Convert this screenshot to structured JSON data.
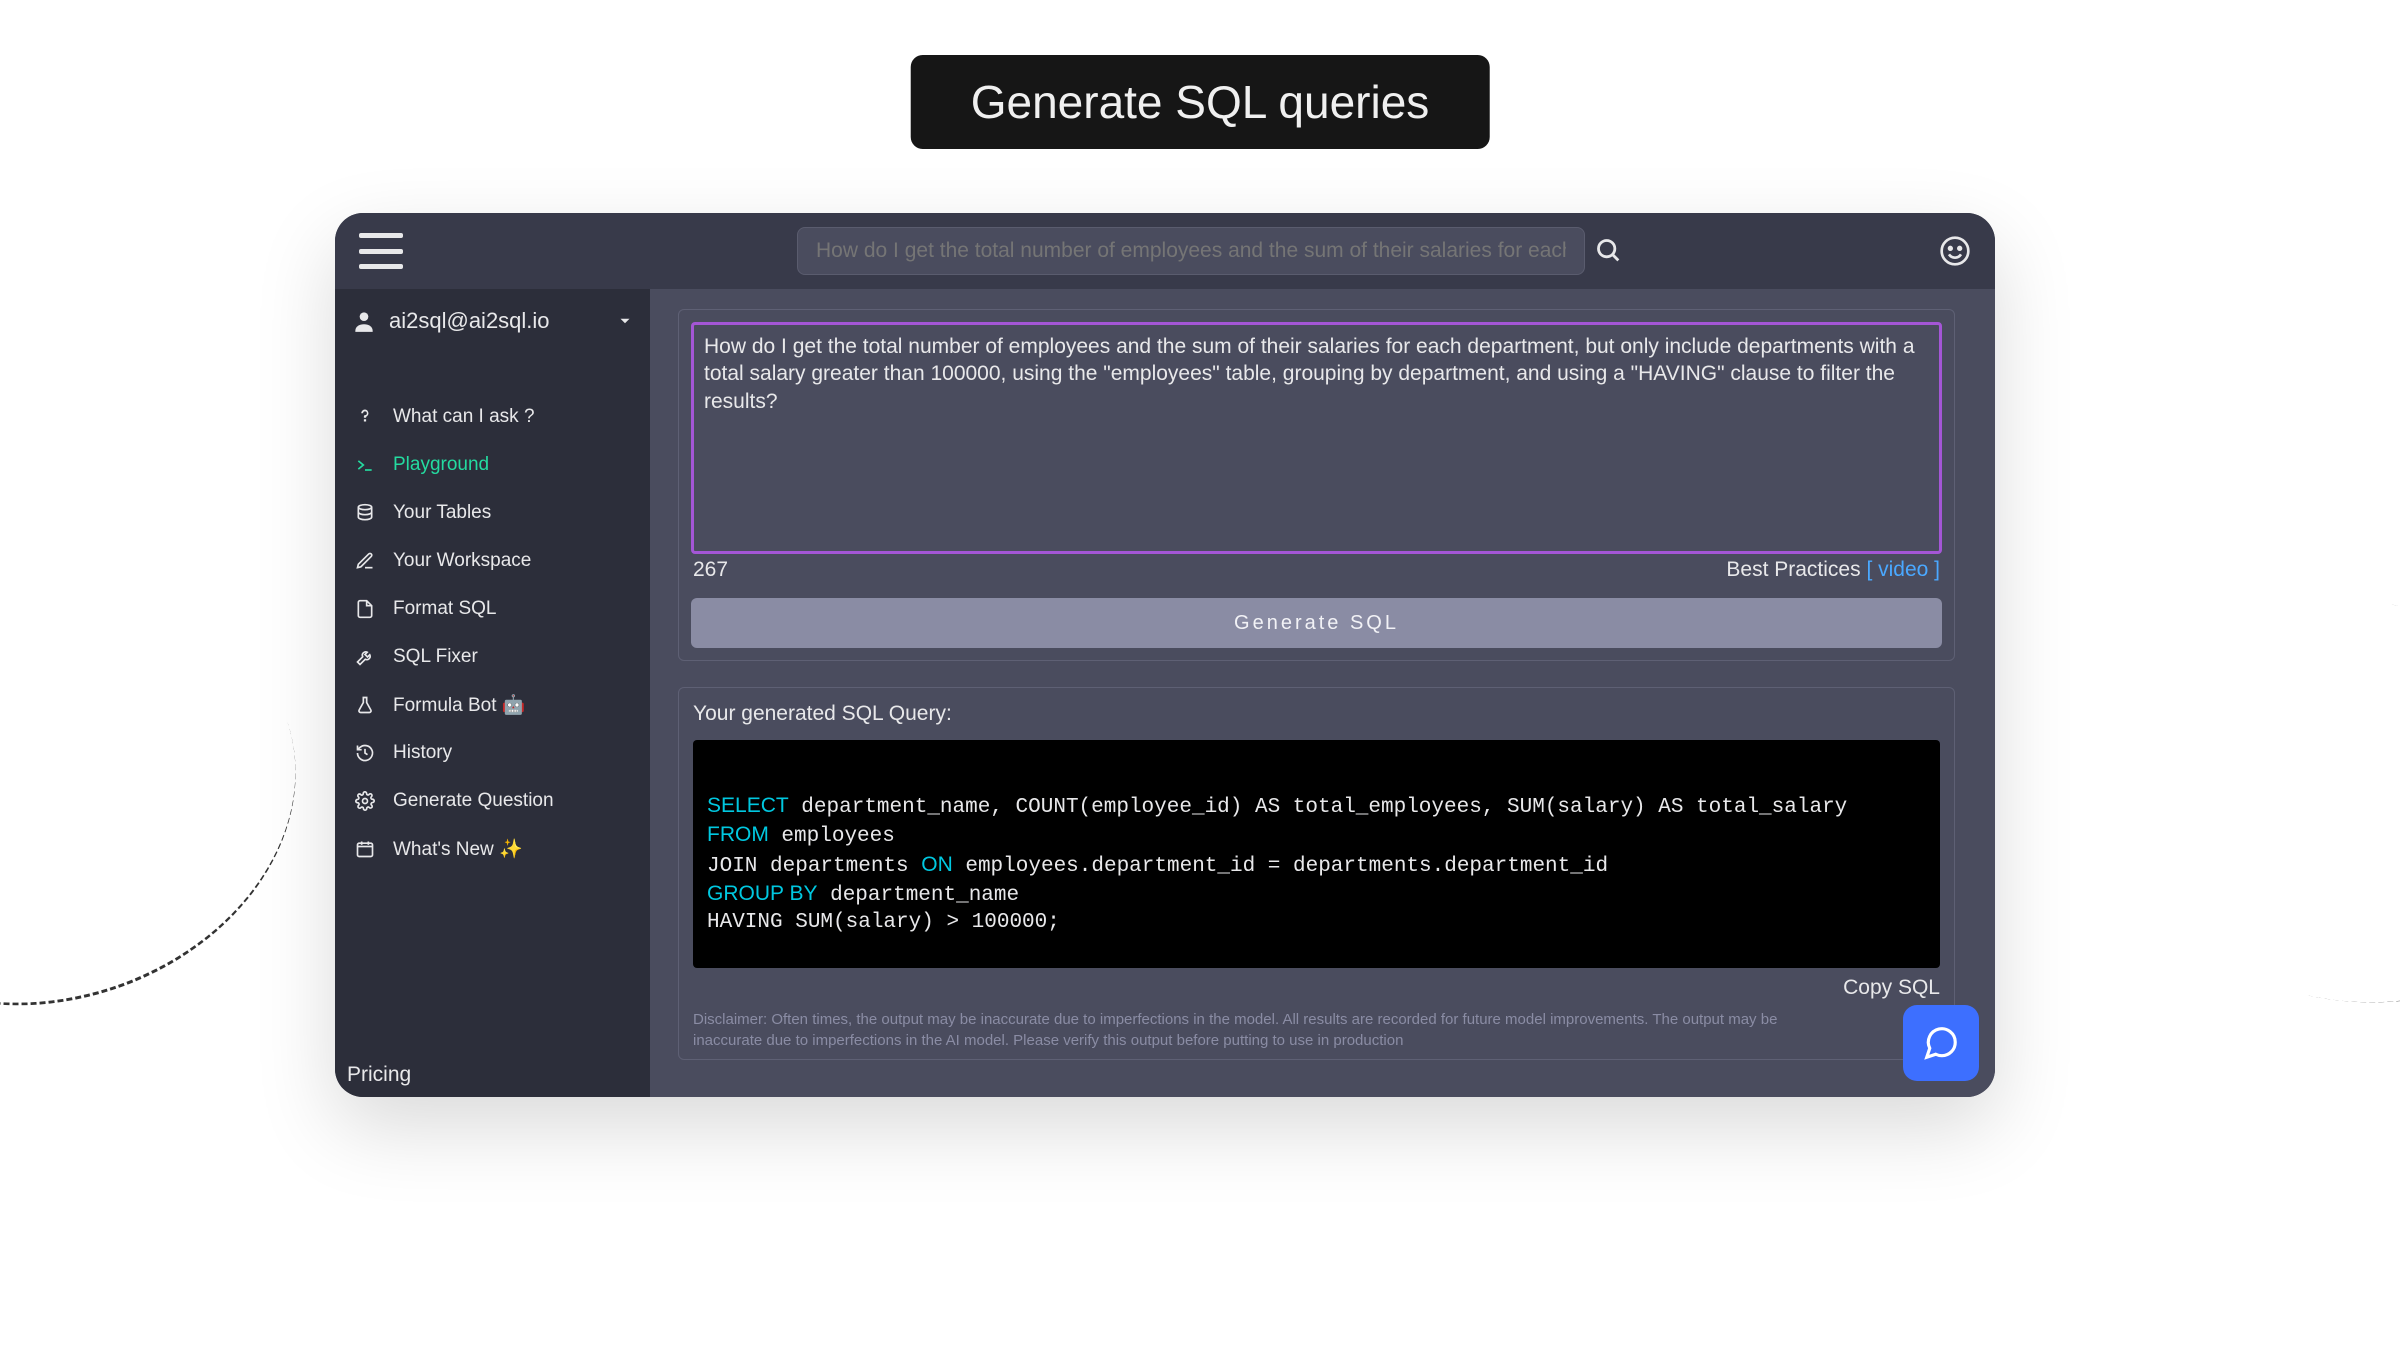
{
  "banner": "Generate SQL queries",
  "search": {
    "placeholder": "How do I get the total number of employees and the sum of their salaries for each depart"
  },
  "account": {
    "email": "ai2sql@ai2sql.io"
  },
  "sidebar": {
    "items": [
      {
        "label": "What can I ask ?",
        "icon": "question"
      },
      {
        "label": "Playground",
        "icon": "terminal",
        "active": true
      },
      {
        "label": "Your Tables",
        "icon": "database"
      },
      {
        "label": "Your Workspace",
        "icon": "edit"
      },
      {
        "label": "Format SQL",
        "icon": "file"
      },
      {
        "label": "SQL Fixer",
        "icon": "wrench"
      },
      {
        "label": "Formula Bot 🤖",
        "icon": "flask"
      },
      {
        "label": "History",
        "icon": "history"
      },
      {
        "label": "Generate Question",
        "icon": "gears"
      },
      {
        "label": "What's New ✨",
        "icon": "calendar"
      }
    ],
    "pricing": "Pricing"
  },
  "prompt": {
    "text": "How do I get the total number of employees and the sum of their salaries for each department, but only include departments with a total salary greater than 100000, using the \"employees\" table, grouping by department, and using a \"HAVING\" clause to filter the results?",
    "charcount": "267",
    "best_practices": "Best Practices",
    "video": "[ video ]",
    "generate_btn": "Generate SQL"
  },
  "output": {
    "title": "Your generated SQL Query:",
    "sql_tokens": [
      {
        "k": true,
        "t": "SELECT"
      },
      {
        "k": false,
        "t": " department_name, COUNT(employee_id) AS total_employees, SUM(salary) AS total_salary\n"
      },
      {
        "k": true,
        "t": "FROM"
      },
      {
        "k": false,
        "t": " employees\n"
      },
      {
        "k": false,
        "t": "JOIN departments "
      },
      {
        "k": true,
        "t": "ON"
      },
      {
        "k": false,
        "t": " employees.department_id = departments.department_id\n"
      },
      {
        "k": true,
        "t": "GROUP BY"
      },
      {
        "k": false,
        "t": " department_name\n"
      },
      {
        "k": false,
        "t": "HAVING SUM(salary) > 100000;"
      }
    ],
    "copy": "Copy SQL",
    "disclaimer": "Disclaimer:  Often times, the output may be inaccurate due to imperfections in the model. All results are recorded for future model improvements. The output may be inaccurate due to imperfections in the AI model. Please verify this output before putting to use in production"
  }
}
